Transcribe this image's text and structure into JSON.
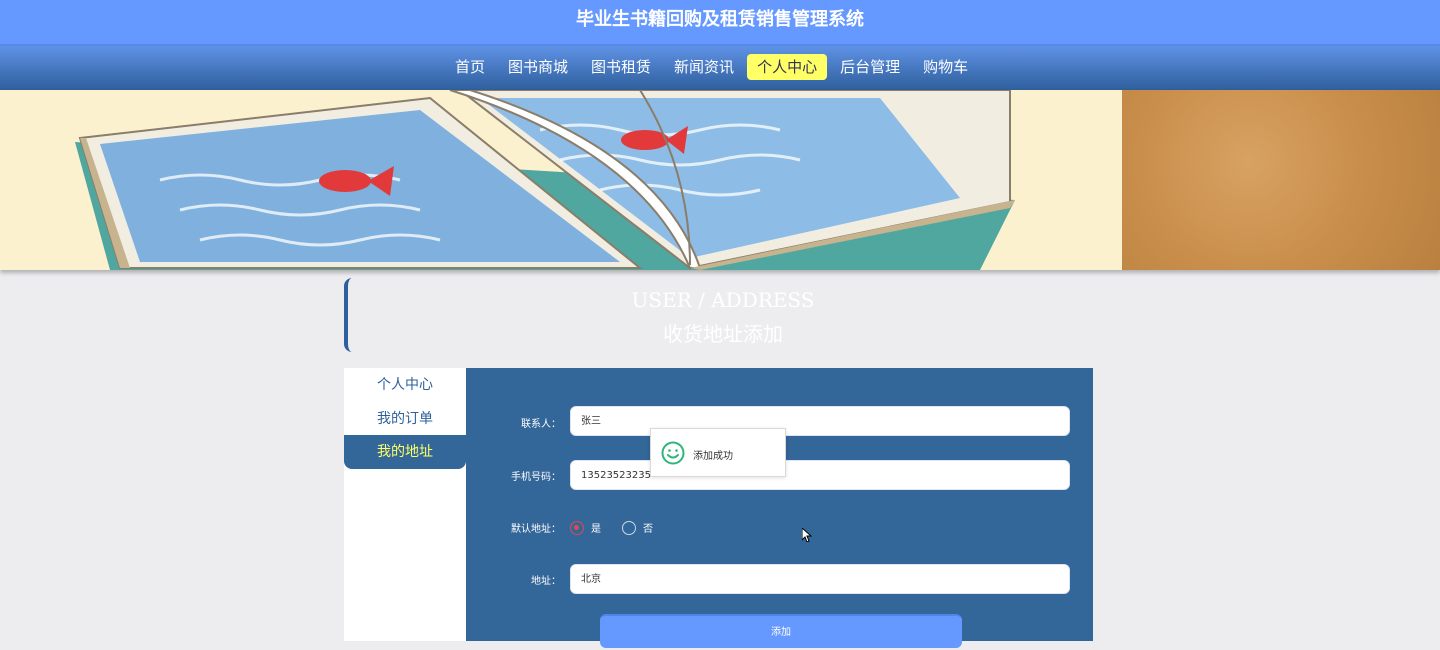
{
  "header": {
    "title": "毕业生书籍回购及租赁销售管理系统"
  },
  "nav": {
    "items": [
      {
        "label": "首页"
      },
      {
        "label": "图书商城"
      },
      {
        "label": "图书租赁"
      },
      {
        "label": "新闻资讯"
      },
      {
        "label": "个人中心",
        "active": true
      },
      {
        "label": "后台管理"
      },
      {
        "label": "购物车"
      }
    ]
  },
  "section": {
    "title_en": "USER / ADDRESS",
    "title_cn": "收货地址添加"
  },
  "sidebar": {
    "items": [
      {
        "label": "个人中心"
      },
      {
        "label": "我的订单"
      },
      {
        "label": "我的地址",
        "active": true
      }
    ]
  },
  "form": {
    "contact_label": "联系人：",
    "contact_value": "张三",
    "phone_label": "手机号码：",
    "phone_value": "13523523235",
    "default_label": "默认地址：",
    "default_yes": "是",
    "default_no": "否",
    "address_label": "地址：",
    "address_value": "北京",
    "submit_label": "添加"
  },
  "toast": {
    "message": "添加成功"
  },
  "colors": {
    "header": "#6699ff",
    "panel": "#336699",
    "active": "#ffff66"
  }
}
